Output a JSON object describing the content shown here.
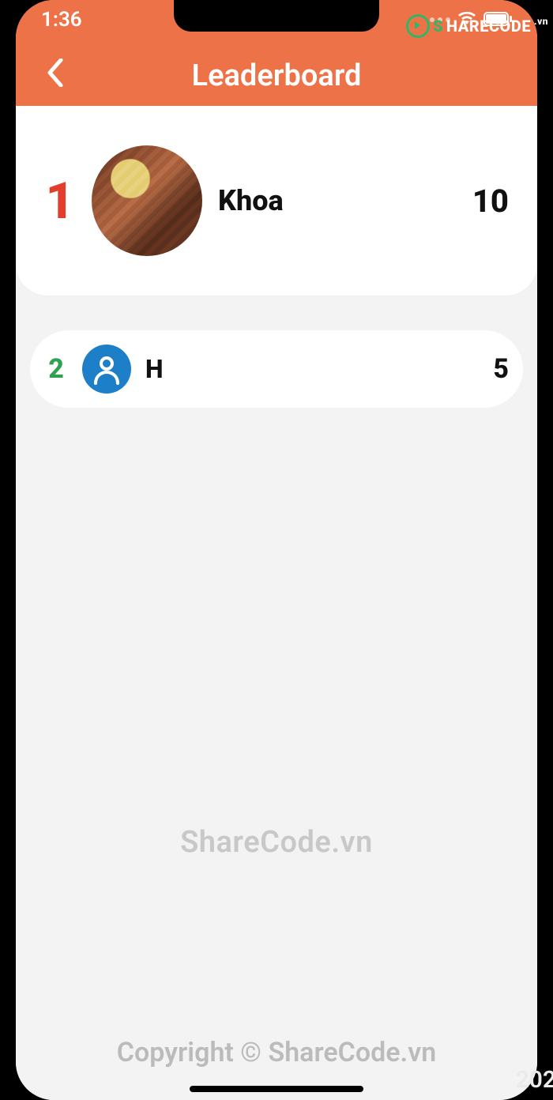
{
  "status": {
    "time": "1:36"
  },
  "header": {
    "title": "Leaderboard"
  },
  "leaderboard": [
    {
      "rank": "1",
      "name": "Khoa",
      "score": "10",
      "avatar_type": "steak"
    },
    {
      "rank": "2",
      "name": "H",
      "score": "5",
      "avatar_type": "person"
    }
  ],
  "watermark": {
    "center": "ShareCode.vn",
    "bottom": "Copyright © ShareCode.vn",
    "badge_green": "S",
    "badge_white": "HARECODE",
    "badge_suffix": ".vn",
    "corner": "202"
  }
}
